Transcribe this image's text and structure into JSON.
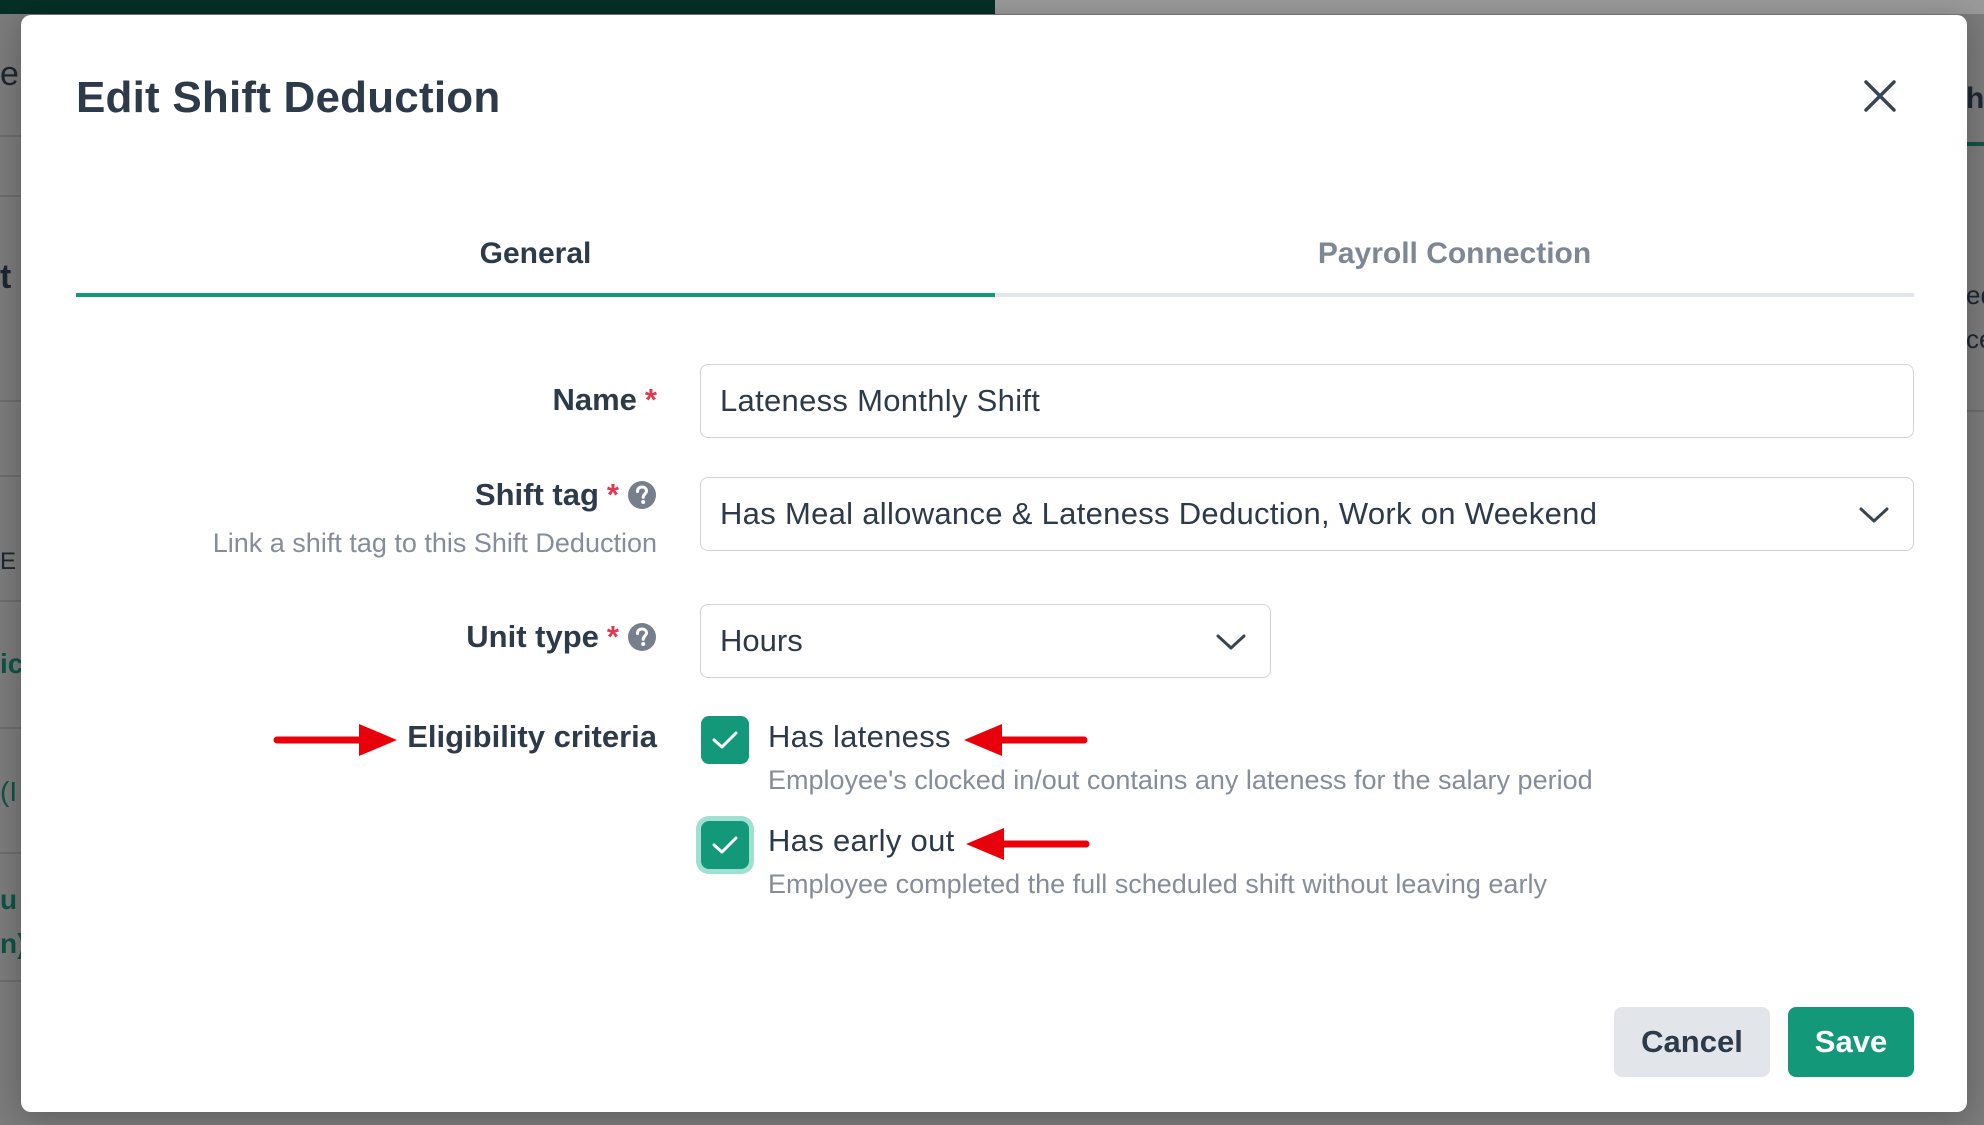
{
  "modal": {
    "title": "Edit Shift Deduction"
  },
  "tabs": [
    {
      "label": "General",
      "active": true
    },
    {
      "label": "Payroll Connection",
      "active": false
    }
  ],
  "form": {
    "name": {
      "label": "Name",
      "required_mark": "*",
      "value": "Lateness Monthly Shift"
    },
    "shift_tag": {
      "label": "Shift tag",
      "required_mark": "*",
      "hint": "Link a shift tag to this Shift Deduction",
      "value": "Has Meal allowance & Lateness Deduction, Work on Weekend"
    },
    "unit_type": {
      "label": "Unit type",
      "required_mark": "*",
      "value": "Hours"
    },
    "eligibility": {
      "label": "Eligibility criteria",
      "options": [
        {
          "label": "Has lateness",
          "description": "Employee's clocked in/out contains any lateness for the salary period",
          "checked": true
        },
        {
          "label": "Has early out",
          "description": "Employee completed the full scheduled shift without leaving early",
          "checked": true
        }
      ]
    }
  },
  "buttons": {
    "cancel": "Cancel",
    "save": "Save"
  },
  "colors": {
    "accent": "#13997a",
    "required": "#e0384f",
    "annotation_arrow": "#e8000b"
  },
  "background_fragments": [
    "e",
    "t",
    "h",
    "ic",
    "(I",
    "u",
    "n)",
    "E",
    "ed",
    "ce"
  ]
}
